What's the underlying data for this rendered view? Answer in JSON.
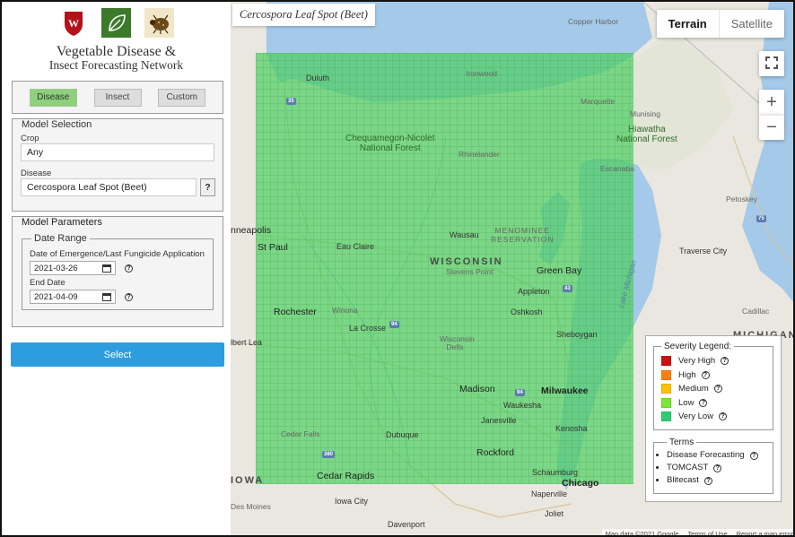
{
  "app": {
    "title_line1": "Vegetable Disease &",
    "title_line2": "Insect Forecasting Network"
  },
  "logos": [
    "uw-crest-icon",
    "leaf-icon",
    "beetle-icon"
  ],
  "tabs": [
    {
      "label": "Disease",
      "active": true
    },
    {
      "label": "Insect",
      "active": false
    },
    {
      "label": "Custom",
      "active": false
    }
  ],
  "model_selection": {
    "legend": "Model Selection",
    "crop_label": "Crop",
    "crop_value": "Any",
    "disease_label": "Disease",
    "disease_value": "Cercospora Leaf Spot (Beet)",
    "help": "?"
  },
  "model_parameters": {
    "legend": "Model Parameters",
    "date_range_legend": "Date Range",
    "start_label": "Date of Emergence/Last Fungicide Application",
    "start_value": "2021-03-26",
    "end_label": "End Date",
    "end_value": "2021-04-09"
  },
  "select_button": "Select",
  "map": {
    "title": "Cercospora Leaf Spot (Beet)",
    "terrain": "Terrain",
    "satellite": "Satellite",
    "zoom_in": "+",
    "zoom_out": "−",
    "attribution": [
      "Map data ©2021 Google",
      "Terms of Use",
      "Report a map error"
    ],
    "labels": {
      "duluth": "Duluth",
      "minneapolis": "nneapolis",
      "st_paul": "St Paul",
      "chequamegon": "Chequamegon-Nicolet",
      "national_forest": "National Forest",
      "hiawatha": "Hiawatha",
      "hiawatha_forest": "National Forest",
      "wisconsin": "WISCONSIN",
      "menominee1": "MENOMINEE",
      "menominee2": "RESERVATION",
      "eau_claire": "Eau Claire",
      "wausau": "Wausau",
      "stevens_point": "Stevens Point",
      "green_bay": "Green Bay",
      "appleton": "Appleton",
      "oshkosh": "Oshkosh",
      "rochester": "Rochester",
      "winona": "Winona",
      "la_crosse": "La Crosse",
      "wisconsin_dells": "Wisconsin Dells",
      "sheboygan": "Sheboygan",
      "albert_lea": "lbert Lea",
      "madison": "Madison",
      "milwaukee": "Milwaukee",
      "waukesha": "Waukesha",
      "janesville": "Janesville",
      "kenosha": "Kenosha",
      "dubuque": "Dubuque",
      "rockford": "Rockford",
      "cedar_falls": "Cedar Falls",
      "cedar_rapids": "Cedar Rapids",
      "schaumburg": "Schaumburg",
      "chicago": "Chicago",
      "iowa_city": "Iowa City",
      "naperville": "Naperville",
      "joliet": "Joliet",
      "davenport": "Davenport",
      "des_moines": "Des Moines",
      "iowa": "IOWA",
      "michigan": "MICHIGAN",
      "marquette": "Marquette",
      "escanaba": "Escanaba",
      "rhinelander": "Rhinelander",
      "traverse_city": "Traverse City",
      "petoskey": "Petoskey",
      "cadillac": "Cadillac",
      "lake_michigan": "Lake Michigan",
      "copper_harbor": "Copper Harbor",
      "munising": "Munising",
      "ironwood": "Ironwood"
    }
  },
  "severity_legend": {
    "title": "Severity Legend:",
    "items": [
      {
        "label": "Very High",
        "color": "#cc1111"
      },
      {
        "label": "High",
        "color": "#ff7f0e"
      },
      {
        "label": "Medium",
        "color": "#ffc000"
      },
      {
        "label": "Low",
        "color": "#7ae835"
      },
      {
        "label": "Very Low",
        "color": "#2ecc71"
      }
    ]
  },
  "terms": {
    "title": "Terms",
    "items": [
      "Disease Forecasting",
      "TOMCAST",
      "Blitecast"
    ]
  },
  "colors": {
    "accent_blue": "#2e9de0",
    "active_tab": "#8ed07c",
    "overlay_green": "#4bce60",
    "water": "#a5c9e8"
  }
}
